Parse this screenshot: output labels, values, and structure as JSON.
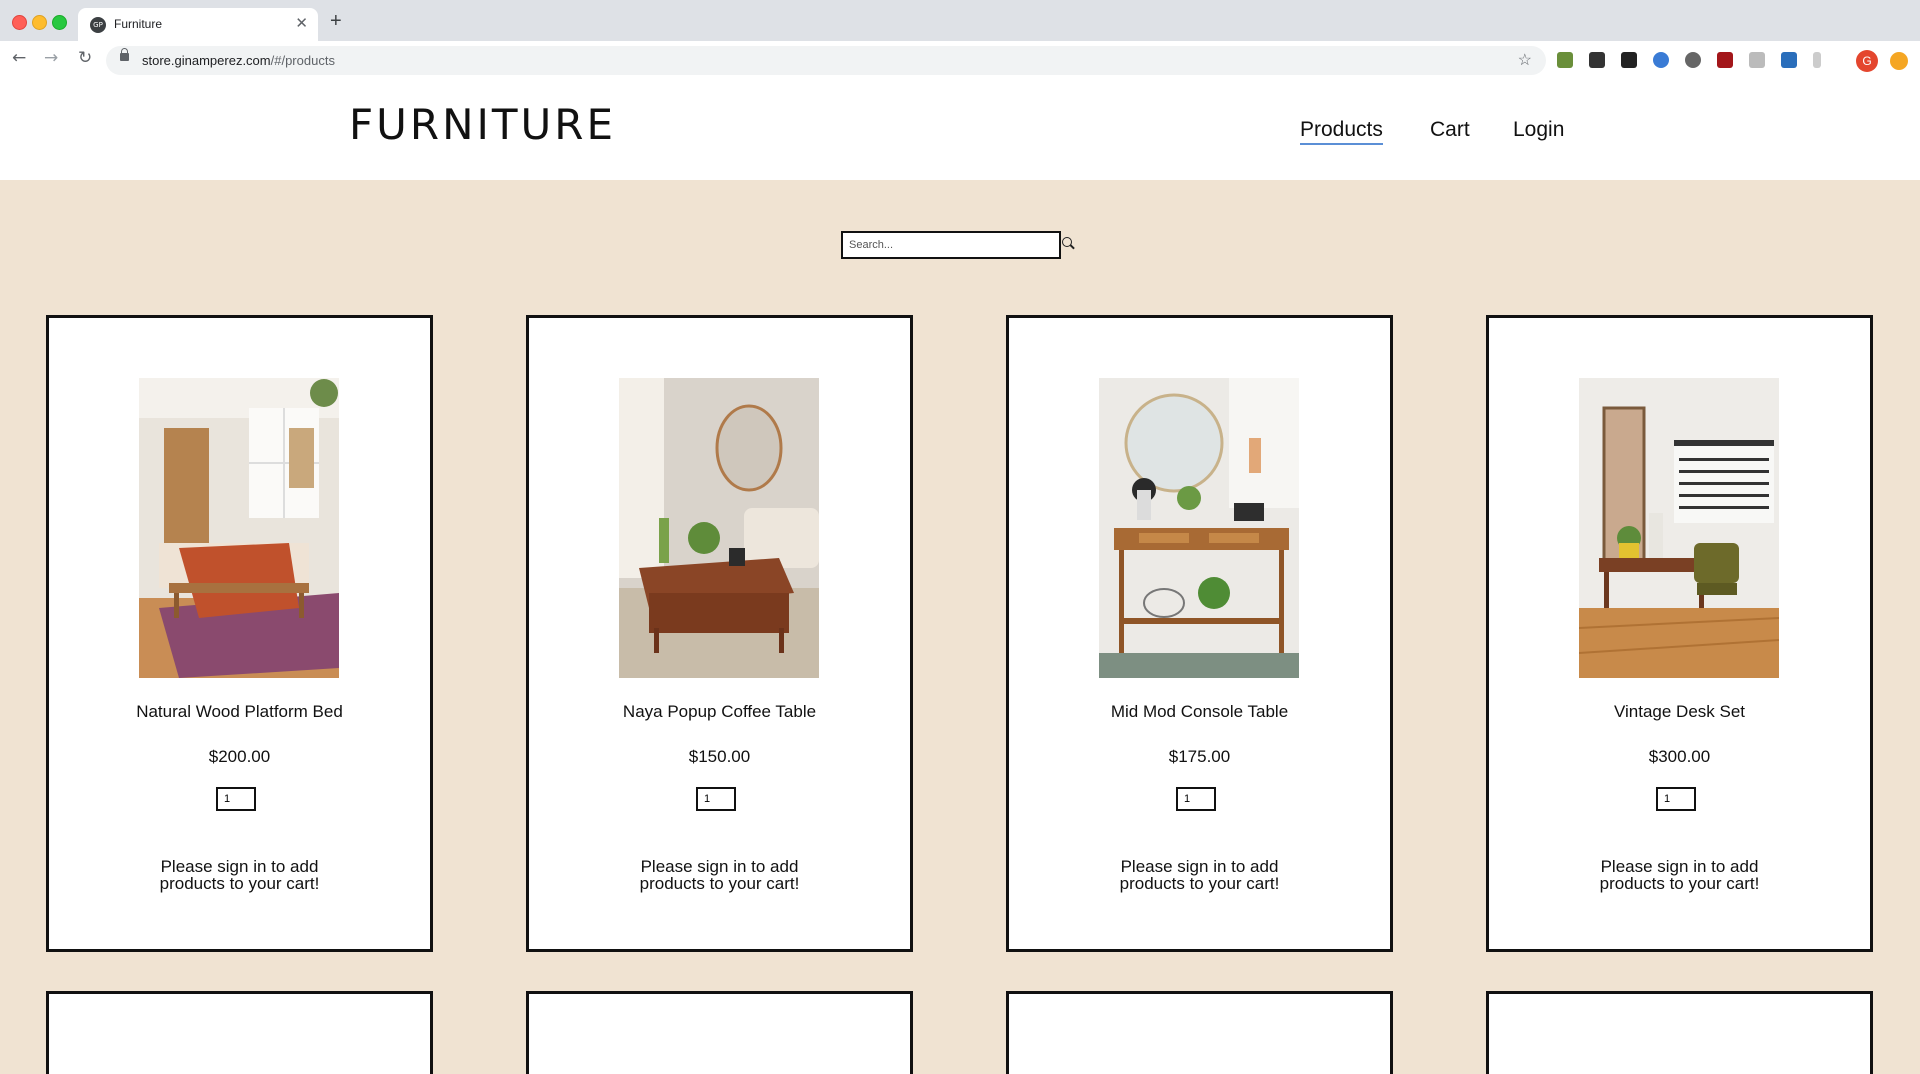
{
  "browser": {
    "tab_title": "Furniture",
    "tab_favicon_text": "GP",
    "url_host": "store.ginamperez.com",
    "url_path": "/#/products",
    "avatar_letter": "G"
  },
  "site": {
    "logo": "FURNITURE",
    "nav": {
      "products": "Products",
      "cart": "Cart",
      "login": "Login"
    },
    "active_nav": "products"
  },
  "search": {
    "placeholder": "Search..."
  },
  "products": [
    {
      "name": "Natural Wood Platform Bed",
      "price": "$200.00",
      "qty": "1",
      "signin_line1": "Please sign in to add",
      "signin_line2": "products to your cart!"
    },
    {
      "name": "Naya Popup Coffee Table",
      "price": "$150.00",
      "qty": "1",
      "signin_line1": "Please sign in to add",
      "signin_line2": "products to your cart!"
    },
    {
      "name": "Mid Mod Console Table",
      "price": "$175.00",
      "qty": "1",
      "signin_line1": "Please sign in to add",
      "signin_line2": "products to your cart!"
    },
    {
      "name": "Vintage Desk Set",
      "price": "$300.00",
      "qty": "1",
      "signin_line1": "Please sign in to add",
      "signin_line2": "products to your cart!"
    }
  ],
  "colors": {
    "page_background": "#f0e3d2",
    "card_border": "#111111",
    "active_nav_underline": "#5b8fd6"
  }
}
